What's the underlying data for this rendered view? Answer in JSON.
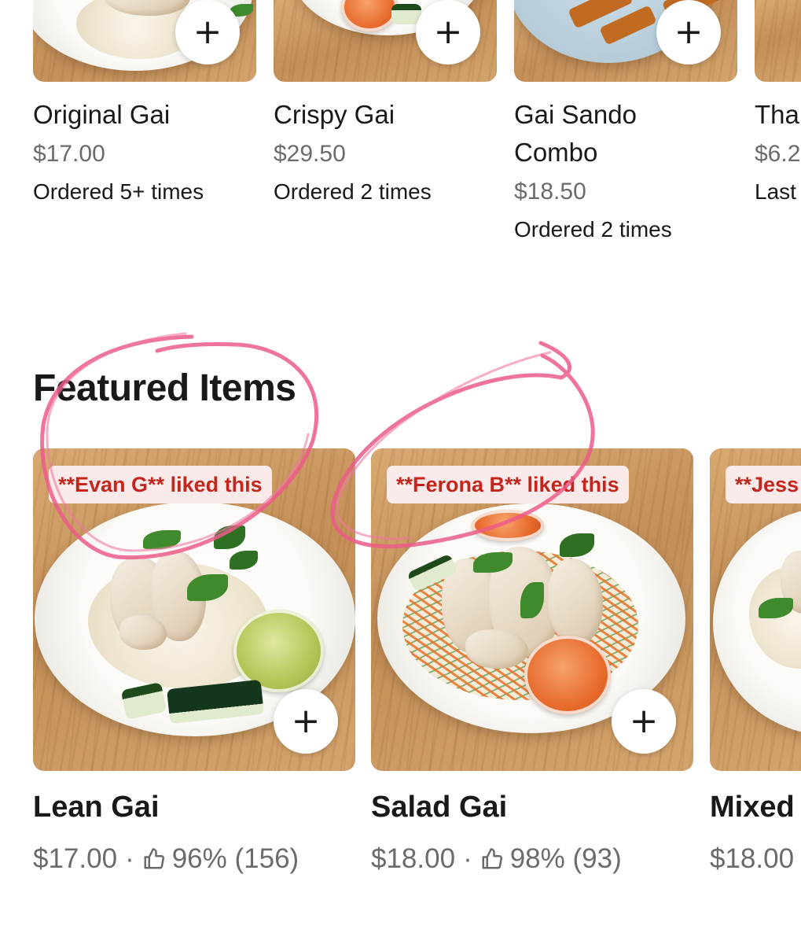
{
  "previously_ordered": [
    {
      "name": "Original Gai",
      "price": "$17.00",
      "ordered": "Ordered 5+ times",
      "add_label": "+"
    },
    {
      "name": "Crispy Gai",
      "price": "$29.50",
      "ordered": "Ordered 2 times",
      "add_label": "+"
    },
    {
      "name_line1": "Gai Sando",
      "name_line2": "Combo",
      "price": "$18.50",
      "ordered": "Ordered 2 times",
      "add_label": "+"
    },
    {
      "name": "Tha",
      "price": "$6.2",
      "ordered": "Last"
    }
  ],
  "featured": {
    "title": "Featured Items",
    "items": [
      {
        "badge": "**Evan G** liked this",
        "name": "Lean Gai",
        "price": "$17.00",
        "separator": "·",
        "rating": "96% (156)",
        "add_label": "+"
      },
      {
        "badge": "**Ferona B** liked this",
        "name": "Salad Gai",
        "price": "$18.00",
        "separator": "·",
        "rating": "98% (93)",
        "add_label": "+"
      },
      {
        "badge": "**Jess",
        "name": "Mixed",
        "price": "$18.00"
      }
    ]
  },
  "icons": {
    "add": "plus-icon",
    "rating": "thumbs-up-icon"
  },
  "colors": {
    "badge_text": "#c4261d",
    "badge_bg": "#fbeaea",
    "annotation": "#ec5c8a"
  }
}
